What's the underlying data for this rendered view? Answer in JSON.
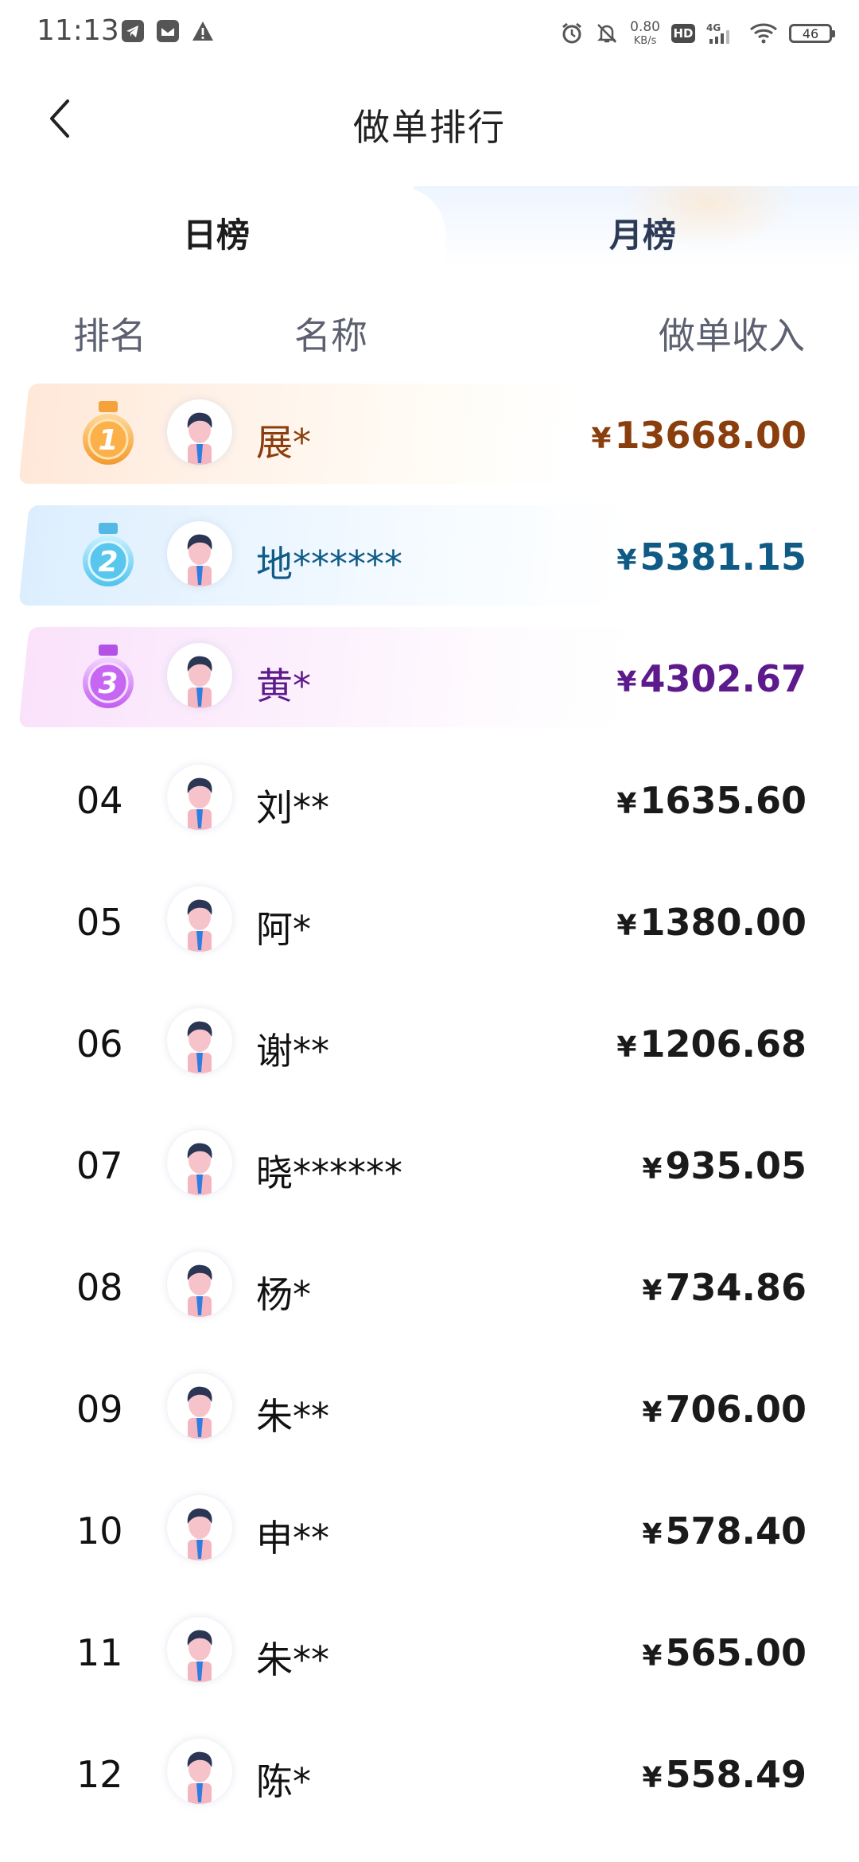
{
  "status_bar": {
    "time": "11:13",
    "speed_value": "0.80",
    "speed_unit": "KB/s",
    "hd": "HD",
    "network": "4G",
    "battery": "46",
    "left_icons": [
      "telegram-icon",
      "mail-icon",
      "warning-icon"
    ],
    "right_icons": [
      "alarm-icon",
      "bell-off-icon",
      "hd-icon",
      "signal-icon",
      "wifi-icon",
      "battery-icon"
    ]
  },
  "header": {
    "title": "做单排行",
    "back_icon": "chevron-left-icon"
  },
  "tabs": [
    {
      "label": "日榜",
      "active": true
    },
    {
      "label": "月榜",
      "active": false
    }
  ],
  "columns": {
    "rank": "排名",
    "name": "名称",
    "income": "做单收入"
  },
  "currency_symbol": "¥",
  "colors": {
    "top1": "#8a3e0d",
    "top2": "#0f5b86",
    "top3": "#5d1a8c",
    "accent_blue": "#2a7cf6"
  },
  "rankings": [
    {
      "rank": "1",
      "name": "展*",
      "income": "13668.00"
    },
    {
      "rank": "2",
      "name": "地******",
      "income": "5381.15"
    },
    {
      "rank": "3",
      "name": "黄*",
      "income": "4302.67"
    },
    {
      "rank": "04",
      "name": "刘**",
      "income": "1635.60"
    },
    {
      "rank": "05",
      "name": "阿*",
      "income": "1380.00"
    },
    {
      "rank": "06",
      "name": "谢**",
      "income": "1206.68"
    },
    {
      "rank": "07",
      "name": "晓******",
      "income": "935.05"
    },
    {
      "rank": "08",
      "name": "杨*",
      "income": "734.86"
    },
    {
      "rank": "09",
      "name": "朱**",
      "income": "706.00"
    },
    {
      "rank": "10",
      "name": "申**",
      "income": "578.40"
    },
    {
      "rank": "11",
      "name": "朱**",
      "income": "565.00"
    },
    {
      "rank": "12",
      "name": "陈*",
      "income": "558.49"
    }
  ]
}
